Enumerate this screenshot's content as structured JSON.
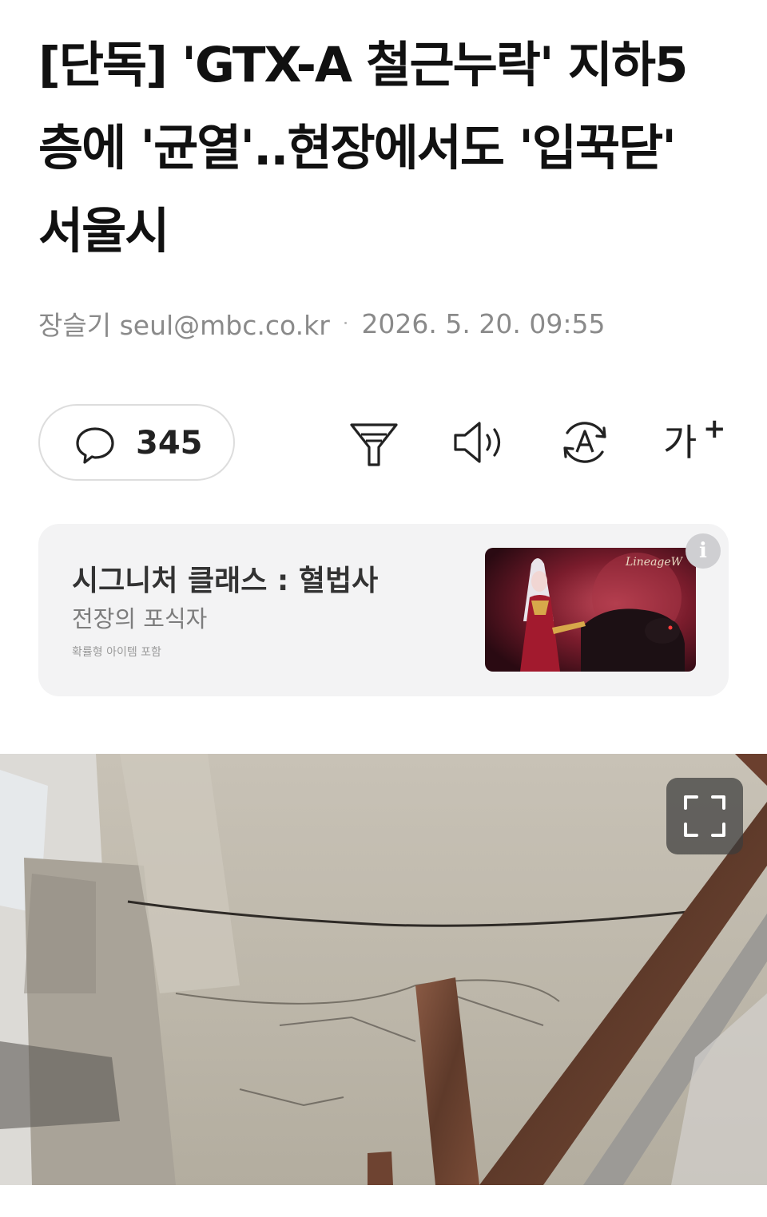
{
  "article": {
    "headline": "[단독] 'GTX-A 철근누락' 지하5층에 '균열'..현장에서도 '입꾹닫' 서울시",
    "author": "장슬기 seul@mbc.co.kr",
    "separator": "·",
    "published": "2026. 5. 20. 09:55"
  },
  "toolbar": {
    "comment_count": "345",
    "comment_icon": "speech-bubble-icon",
    "summary_icon": "filter-funnel-icon",
    "listen_icon": "speaker-icon",
    "translate_icon": "translate-a-icon",
    "font_size_label": "가",
    "font_size_plus": "+"
  },
  "ad": {
    "title": "시그니처 클래스 : 혈법사",
    "subtitle": "전장의 포식자",
    "disclaimer": "확률형 아이템 포함",
    "image_brand": "LineageW",
    "info_icon_label": "i"
  },
  "photo": {
    "expand_icon": "fullscreen-expand-icon"
  },
  "colors": {
    "headline": "#111111",
    "meta": "#8a8a8a",
    "ad_background": "#f3f3f4",
    "pill_border": "#dddddd"
  }
}
